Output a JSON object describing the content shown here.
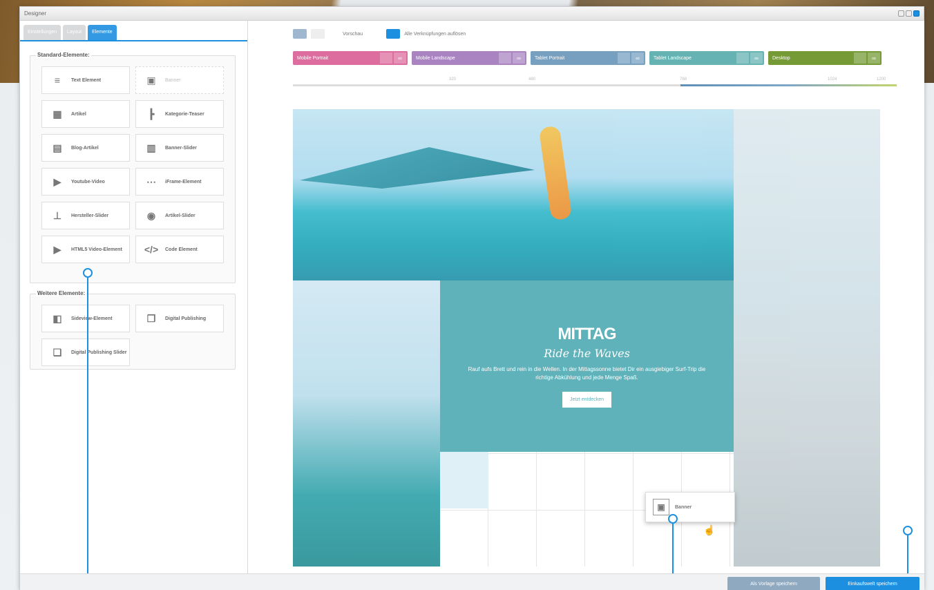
{
  "window": {
    "title": "Designer"
  },
  "left": {
    "tabs": [
      {
        "label": "Einstellungen",
        "active": false
      },
      {
        "label": "Layout",
        "active": false
      },
      {
        "label": "Elemente",
        "active": true
      }
    ],
    "standard_legend": "Standard-Elemente:",
    "standard_items": [
      {
        "label": "Text Element",
        "icon": "text-lines-icon",
        "glyph": "≡",
        "disabled": false
      },
      {
        "label": "Banner",
        "icon": "image-icon",
        "glyph": "▣",
        "disabled": true
      },
      {
        "label": "Artikel",
        "icon": "box-icon",
        "glyph": "▦",
        "disabled": false
      },
      {
        "label": "Kategorie-Teaser",
        "icon": "tree-icon",
        "glyph": "┣",
        "disabled": false
      },
      {
        "label": "Blog-Artikel",
        "icon": "blog-icon",
        "glyph": "▤",
        "disabled": false
      },
      {
        "label": "Banner-Slider",
        "icon": "slider-icon",
        "glyph": "▥",
        "disabled": false
      },
      {
        "label": "Youtube-Video",
        "icon": "video-icon",
        "glyph": "▶",
        "disabled": false
      },
      {
        "label": "iFrame-Element",
        "icon": "iframe-icon",
        "glyph": "⋯",
        "disabled": false
      },
      {
        "label": "Hersteller-Slider",
        "icon": "brand-slider-icon",
        "glyph": "⊥",
        "disabled": false
      },
      {
        "label": "Artikel-Slider",
        "icon": "article-slider-icon",
        "glyph": "◉",
        "disabled": false
      },
      {
        "label": "HTML5 Video-Element",
        "icon": "html5-video-icon",
        "glyph": "▶",
        "disabled": false
      },
      {
        "label": "Code Element",
        "icon": "code-icon",
        "glyph": "</>",
        "disabled": false
      }
    ],
    "more_legend": "Weitere Elemente:",
    "more_items": [
      {
        "label": "Sideview-Element",
        "icon": "sideview-icon",
        "glyph": "◧"
      },
      {
        "label": "Digital Publishing",
        "icon": "publishing-icon",
        "glyph": "❐"
      },
      {
        "label": "Digital Publishing Slider",
        "icon": "publishing-slider-icon",
        "glyph": "❏"
      }
    ]
  },
  "toolbar": {
    "preview_label": "Vorschau",
    "unlink_label": "Alle Verknüpfungen auflösen"
  },
  "breakpoints": [
    {
      "label": "Mobile Portrait",
      "color": "#d9548f"
    },
    {
      "label": "Mobile Landscape",
      "color": "#9b6fb7"
    },
    {
      "label": "Tablet Portrait",
      "color": "#5f8fb6"
    },
    {
      "label": "Tablet Landscape",
      "color": "#4ba6a6"
    },
    {
      "label": "Desktop",
      "color": "#5f8a14"
    }
  ],
  "ruler_ticks": [
    "320",
    "480",
    "768",
    "1024",
    "1200"
  ],
  "teaser": {
    "brand": "MITTAG",
    "tagline": "Ride the Waves",
    "description": "Rauf aufs Brett und rein in die Wellen. In der Mittagssonne bietet Dir ein ausgiebiger Surf-Trip die richtige Abkühlung und jede Menge Spaß.",
    "cta": "Jetzt entdecken"
  },
  "drag_ghost": {
    "label": "Banner"
  },
  "footer": {
    "save_template": "Als Vorlage speichern",
    "save_world": "Einkaufswelt speichern"
  },
  "colors": {
    "accent": "#1d8fe0",
    "teal": "#4aa8b0"
  }
}
